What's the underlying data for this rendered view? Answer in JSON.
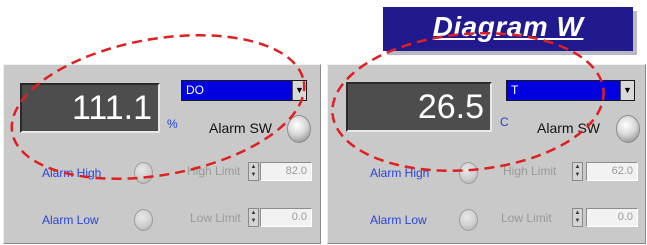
{
  "title": "Diagram W",
  "panels": {
    "left": {
      "value": "111.1",
      "unit": "%",
      "parameter": "DO",
      "alarm_sw_label": "Alarm SW",
      "alarm_high_label": "Alarm High",
      "alarm_low_label": "Alarm Low",
      "high_limit_label": "High Limit",
      "low_limit_label": "Low Limit",
      "high_limit_value": "82.0",
      "low_limit_value": "0.0"
    },
    "right": {
      "value": "26.5",
      "unit": "C",
      "parameter": "T",
      "alarm_sw_label": "Alarm SW",
      "alarm_high_label": "Alarm High",
      "alarm_low_label": "Alarm Low",
      "high_limit_label": "High Limit",
      "low_limit_label": "Low Limit",
      "high_limit_value": "62.0",
      "low_limit_value": "0.0"
    }
  },
  "colors": {
    "title_bg": "#211a8e",
    "panel_bg": "#c9c9c9",
    "display_bg": "#4d4d4d",
    "select_bg": "#0000e0",
    "label_blue": "#2a44d8",
    "annotation_red": "#e02020"
  },
  "icons": {
    "alarm_switch": "toggle-switch-icon",
    "alarm_led": "led-indicator-icon",
    "dropdown": "chevron-down-icon",
    "spinner": "up-down-arrows-icon"
  }
}
